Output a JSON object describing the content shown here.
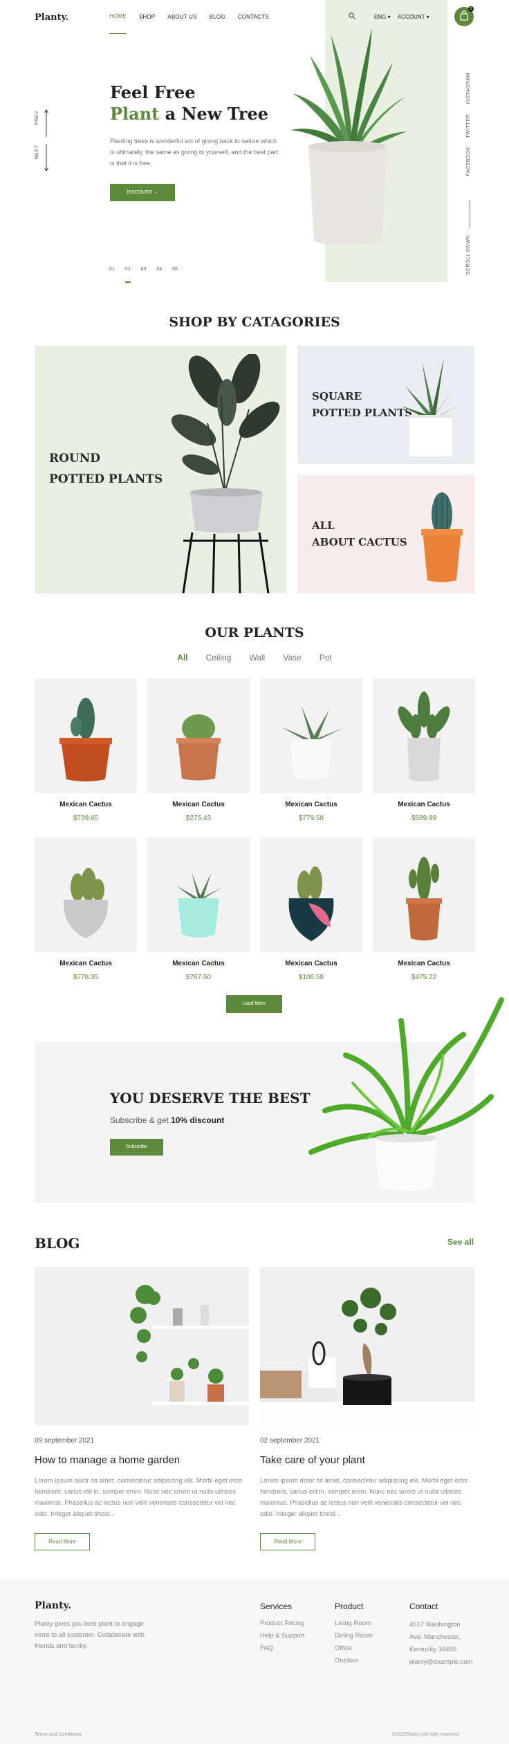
{
  "header": {
    "logo": "Planty.",
    "nav": [
      "HOME",
      "SHOP",
      "ABOUT US",
      "BLOG",
      "CONTACTS"
    ],
    "language": "ENG",
    "account": "ACCOUNT",
    "cart_count": "0"
  },
  "hero": {
    "title_line1": "Feel Free",
    "title_green": "Plant",
    "title_rest": " a New Tree",
    "text": "Planting trees is wonderful act of giving back to nature which is ultimately, the same as giving to yourself, and the best part is that it is free.",
    "button": "DISCOVER",
    "prev": "PREV",
    "next": "NEXT",
    "slides": [
      "01",
      "02",
      "03",
      "04",
      "05"
    ],
    "active_slide": "02",
    "social": [
      "INSTAGRAM",
      "TWITTER",
      "FACEBOOK"
    ],
    "scroll": "SCROLL DOWN"
  },
  "categories": {
    "title": "SHOP BY CATAGORIES",
    "round_l1": "ROUND",
    "round_l2": "POTTED PLANTS",
    "square_l1": "SQUARE",
    "square_l2": "POTTED PLANTS",
    "cactus_l1": "ALL",
    "cactus_l2": "ABOUT CACTUS"
  },
  "plants": {
    "title": "OUR PLANTS",
    "filters": [
      "All",
      "Ceiling",
      "Wall",
      "Vase",
      "Pot"
    ],
    "items": [
      {
        "name": "Mexican Cactus",
        "price": "$739.65"
      },
      {
        "name": "Mexican Cactus",
        "price": "$275.43"
      },
      {
        "name": "Mexican Cactus",
        "price": "$779.58"
      },
      {
        "name": "Mexican Cactus",
        "price": "$589.99"
      },
      {
        "name": "Mexican Cactus",
        "price": "$778.35"
      },
      {
        "name": "Mexican Cactus",
        "price": "$767.50"
      },
      {
        "name": "Mexican Cactus",
        "price": "$106.58"
      },
      {
        "name": "Mexican Cactus",
        "price": "$475.22"
      }
    ],
    "load_more": "Load More"
  },
  "subscribe": {
    "title": "YOU DESERVE THE BEST",
    "text_prefix": "Subscribe & get ",
    "text_bold": "10% discount",
    "button": "Subscribe"
  },
  "blog": {
    "title": "BLOG",
    "see_all": "See all",
    "posts": [
      {
        "date": "09 september 2021",
        "title": "How to manage a home garden",
        "text": "Lorem ipsum dolor sit amet, consectetur adipiscing elit. Morbi eget eros hendrerit, varius elit in, semper enim. Nunc nec lorem ut nulla ultrices maximus. Phasellus ac lectus non velit venenatis consectetur vel nec odio. Integer aliquet tincid...",
        "button": "Read More"
      },
      {
        "date": "02 september 2021",
        "title": "Take care of your plant",
        "text": "Lorem ipsum dolor sit amet, consectetur adipiscing elit. Morbi eget eros hendrerit, varius elit in, semper enim. Nunc nec lorem ut nulla ultrices maximus. Phasellus ac lectus non velit venenatis consectetur vel nec odio. Integer aliquet tincid...",
        "button": "Read More"
      }
    ]
  },
  "footer": {
    "logo": "Planty.",
    "desc": "Planty gives you best plant to engage more to all customer. Collaborate with friends and family.",
    "services_head": "Services",
    "services": [
      "Product Pricing",
      "Help & Support",
      "FAQ"
    ],
    "product_head": "Product",
    "product": [
      "Living Room",
      "Dining Room",
      "Office",
      "Outdoor"
    ],
    "contact_head": "Contact",
    "contact": [
      "4517 Washington",
      "Ave. Manchester,",
      "Kentucky 39495",
      "planty@example.com"
    ],
    "terms": "Terms and Conditions",
    "copyright": "©2021Planty  |  All right reserved"
  },
  "colors": {
    "accent": "#5c8a3a",
    "hero_bg": "#e9f0e2",
    "square_bg": "#ecedf2",
    "cactus_bg": "#f6eced"
  }
}
